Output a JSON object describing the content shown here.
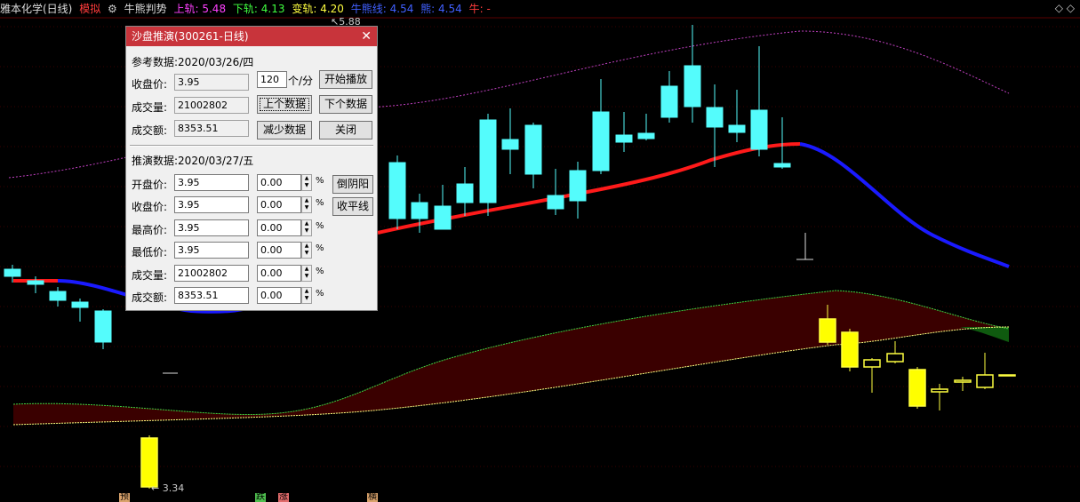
{
  "header": {
    "stock_name": "雅本化学(日线)",
    "mode": "模拟",
    "indicator_name": "牛熊判势",
    "upper_label": "上轨:",
    "upper_value": "5.48",
    "lower_label": "下轨:",
    "lower_value": "4.13",
    "change_label": "变轨:",
    "change_value": "4.20",
    "bullbear_label": "牛熊线:",
    "bullbear_value": "4.54",
    "bear_label": "熊:",
    "bear_value": "4.54",
    "bull_label": "牛:",
    "bull_value": "-",
    "corner_glyph": "◇ ◇"
  },
  "price_labels": {
    "high": "5.88",
    "low": "3.34"
  },
  "bottom_tags": [
    {
      "text": "预",
      "color": "#d9a26b"
    },
    {
      "text": "跌",
      "color": "#4fbf4f"
    },
    {
      "text": "涨",
      "color": "#e26b6b"
    },
    {
      "text": "横",
      "color": "#d9a26b"
    }
  ],
  "dialog": {
    "title": "沙盘推演(300261-日线)",
    "close_glyph": "✕",
    "ref_label": "参考数据:2020/03/26/四",
    "close_price_label": "收盘价:",
    "close_price": "3.95",
    "volume_label": "成交量:",
    "volume": "21002802",
    "amount_label": "成交额:",
    "amount": "8353.51",
    "speed_value": "120",
    "speed_unit": "个/分",
    "btn_play": "开始播放",
    "btn_prev": "上个数据",
    "btn_next": "下个数据",
    "btn_less": "减少数据",
    "btn_close": "关闭",
    "proj_label": "推演数据:2020/03/27/五",
    "rows": [
      {
        "label": "开盘价:",
        "value": "3.95",
        "pct": "0.00"
      },
      {
        "label": "收盘价:",
        "value": "3.95",
        "pct": "0.00"
      },
      {
        "label": "最高价:",
        "value": "3.95",
        "pct": "0.00"
      },
      {
        "label": "最低价:",
        "value": "3.95",
        "pct": "0.00"
      },
      {
        "label": "成交量:",
        "value": "21002802",
        "pct": "0.00"
      },
      {
        "label": "成交额:",
        "value": "8353.51",
        "pct": "0.00"
      }
    ],
    "pct_sign": "%",
    "btn_reverse": "倒阴阳",
    "btn_flat": "收平线"
  },
  "colors": {
    "up": "#ff3c3c",
    "down": "#54fcfc",
    "bull": "#ff0000",
    "bear": "#0000ff",
    "upper_band": "#c040c0",
    "ghost": "#ffff00"
  }
}
